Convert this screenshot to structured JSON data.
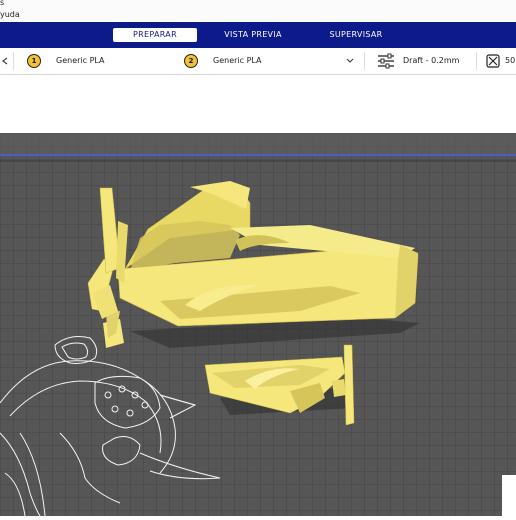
{
  "menu": {
    "partial_items": [
      "s",
      "yuda"
    ]
  },
  "stages": {
    "tabs": [
      {
        "label": "PREPARAR",
        "active": true
      },
      {
        "label": "VISTA PREVIA",
        "active": false
      },
      {
        "label": "SUPERVISAR",
        "active": false
      }
    ]
  },
  "toolbar": {
    "extruder1": {
      "number": "1",
      "material": "Generic PLA"
    },
    "extruder2": {
      "number": "2",
      "material": "Generic PLA"
    },
    "profile": "Draft - 0.2mm",
    "infill_partial": "50"
  },
  "colors": {
    "stage_bar": "#0d1a8a",
    "extruder_badge": "#f2c230",
    "build_plate": "#555555",
    "model": "#f5e77c",
    "axis_line": "#3a66ff"
  },
  "icons": [
    "chevron-left-icon",
    "chevron-down-icon",
    "settings-sliders-icon",
    "support-icon"
  ]
}
